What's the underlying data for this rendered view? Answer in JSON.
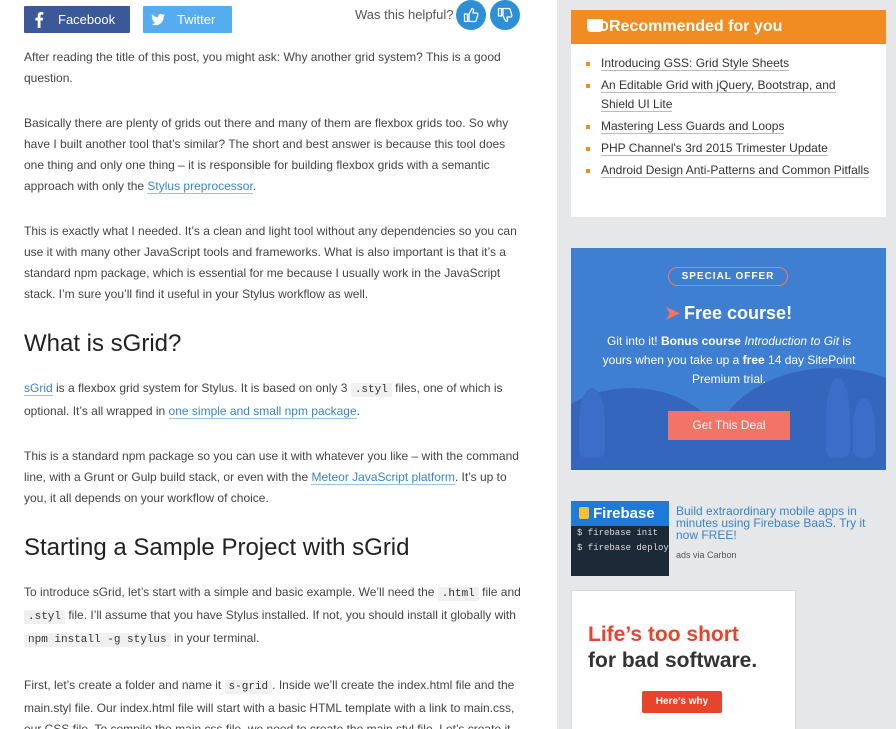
{
  "share": {
    "facebook_label": "Facebook",
    "twitter_label": "Twitter",
    "helpful_question": "Was this helpful?"
  },
  "article": {
    "p1": "After reading the title of this post, you might ask: Why another grid system? This is a good question.",
    "p2_text": "Basically there are plenty of grids out there and many of them are flexbox grids too. So why have I built another tool that’s similar? The short and best answer is because this tool does one thing and only one thing – it is responsible for building flexbox grids with a semantic approach with only the ",
    "p2_link": "Stylus preprocessor",
    "p2_end": ".",
    "p3": "This is exactly what I needed. It’s a clean and light tool without any dependencies so you can use it with many other JavaScript tools and frameworks. What is also important is that it’s a standard npm package, which is essential for me because I usually work in the JavaScript stack. I’m sure you’ll find it useful in your Stylus workflow as well.",
    "h2_1": "What is sGrid?",
    "p4_link1": "sGrid",
    "p4_text1": " is a flexbox grid system for Stylus. It is based on only 3 ",
    "p4_code": ".styl",
    "p4_text2": " files, one of which is optional. It’s all wrapped in ",
    "p4_link2": "one simple and small npm package",
    "p4_end": ".",
    "p5_text": "This is a standard npm package so you can use it with whatever you like – with the command line, with a Grunt or Gulp build stack, or even with the ",
    "p5_link": "Meteor JavaScript platform",
    "p5_end": ". It’s up to you, it all depends on your workflow of choice.",
    "h2_2": "Starting a Sample Project with sGrid",
    "p6_text1": "To introduce sGrid, let’s start with a simple and basic example. We’ll need the ",
    "p6_code1": ".html",
    "p6_text2": " file and ",
    "p6_code2": ".styl",
    "p6_text3": " file. I’ll assume that you have Stylus installed. If not, you should install it globally with ",
    "p6_code3": "npm install -g stylus",
    "p6_text4": " in your terminal.",
    "p7_text1": "First, let’s create a folder and name it ",
    "p7_code": "s-grid",
    "p7_text2": ". Inside we’ll create the index.html file and the main.styl file. Our index.html file will start with a basic HTML template with a link to main.css, our CSS file. To compile the main.css file, we need to create the main.styl file. Let’s create it"
  },
  "sidebar": {
    "recommended_title": "Recommended for you",
    "recommended": [
      "Introducing GSS: Grid Style Sheets",
      "An Editable Grid with jQuery, Bootstrap, and Shield UI Lite",
      "Mastering Less Guards and Loops",
      "PHP Channel's 3rd 2015 Trimester Update",
      "Android Design Anti-Patterns and Common Pitfalls"
    ],
    "offer": {
      "badge": "SPECIAL OFFER",
      "title": "Free course!",
      "t1": "Git into it! ",
      "t2": "Bonus course ",
      "t3": "Introduction to Git",
      "t4": " is yours when you take up a ",
      "t5": "free",
      "t6": " 14 day SitePoint Premium trial.",
      "button": "Get This Deal"
    },
    "carbon": {
      "brand": "Firebase",
      "cmd1": "$ firebase init",
      "cmd2": "$ firebase deploy",
      "text": "Build extraordinary mobile apps in minutes using Firebase BaaS. Try it now FREE!",
      "via": "ads via Carbon"
    },
    "banner": {
      "line1": "Life’s too short",
      "line2": "for bad software.",
      "button": "Here’s why"
    }
  },
  "colors": {
    "facebook": "#3b5998",
    "twitter": "#55acee",
    "vote": "#2d8fd5",
    "link": "#3a84c4",
    "recommended_header": "#f08c22",
    "offer_bg": "#3f7fd1",
    "offer_accent": "#f37466"
  }
}
